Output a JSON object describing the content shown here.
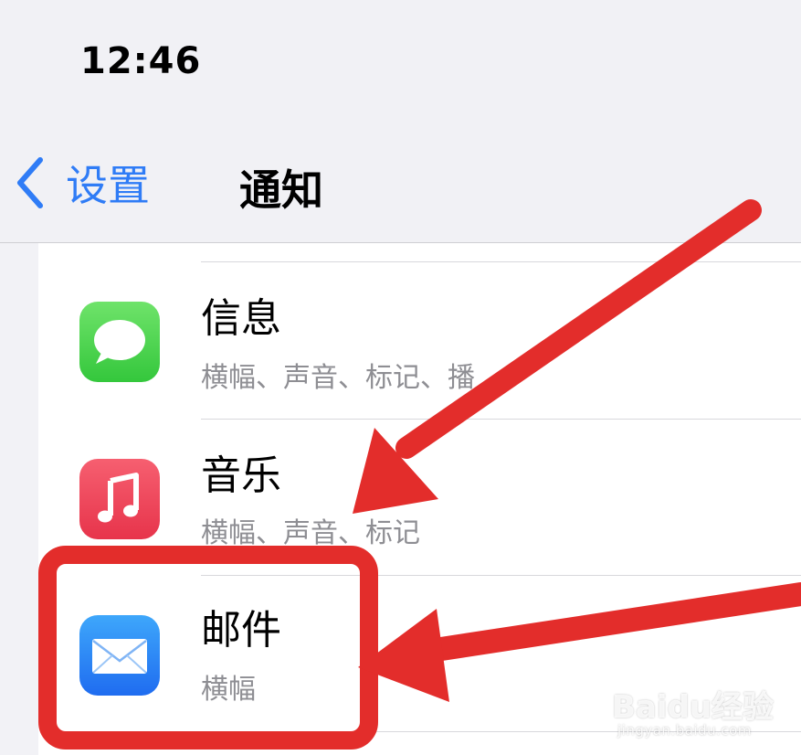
{
  "status_bar": {
    "time": "12:46"
  },
  "nav": {
    "back_label": "设置",
    "title": "通知"
  },
  "apps": [
    {
      "name": "信息",
      "subtitle": "横幅、声音、标记、播",
      "icon": "messages-icon",
      "color": "#4cd964"
    },
    {
      "name": "音乐",
      "subtitle": "横幅、声音、标记",
      "icon": "music-icon",
      "color": "#f0455b"
    },
    {
      "name": "邮件",
      "subtitle": "横幅",
      "icon": "mail-icon",
      "color": "#2f8df6"
    }
  ],
  "annotation": {
    "color": "#e32d2b"
  },
  "watermark": {
    "brand": "Baidu经验",
    "url": "jingyan.baidu.com"
  }
}
